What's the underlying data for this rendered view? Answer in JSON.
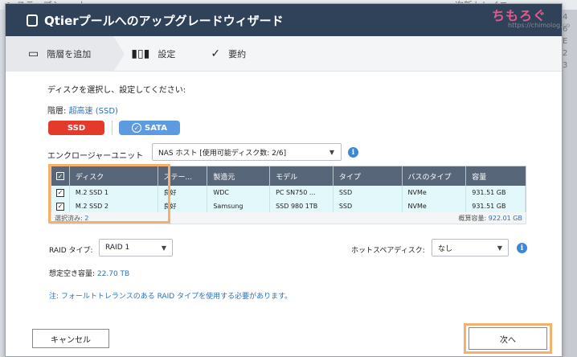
{
  "background": {
    "left_text": "ヘ ステップショット",
    "right_text": "次新トレイニー",
    "right_side": [
      "4",
      "6",
      "E",
      "2",
      "3"
    ]
  },
  "watermark": {
    "title": "ちもろぐ",
    "url": "https://chimolog.co"
  },
  "dialog": {
    "title": "Qtierプールへのアップグレードウィザード",
    "steps": [
      {
        "label": "階層を追加",
        "icon": "drive-icon"
      },
      {
        "label": "設定",
        "icon": "settings-icon"
      },
      {
        "label": "要約",
        "icon": "check-circle-icon"
      }
    ]
  },
  "form": {
    "heading": "ディスクを選択し、設定してください:",
    "tier_label": "階層:",
    "tier_value": "超高速 (SSD)",
    "tier_buttons": {
      "ssd": "SSD",
      "sata": "SATA"
    },
    "enclosure_label": "エンクロージャーユニット",
    "enclosure_value": "NAS ホスト [使用可能ディスク数: 2/6]",
    "table": {
      "headers": [
        "ディスク",
        "ステー...",
        "製造元",
        "モデル",
        "タイプ",
        "バスのタイプ",
        "容量"
      ],
      "rows": [
        [
          "M.2 SSD 1",
          "良好",
          "WDC",
          "PC SN750 ...",
          "SSD",
          "NVMe",
          "931.51 GB"
        ],
        [
          "M.2 SSD 2",
          "良好",
          "Samsung",
          "SSD 980 1TB",
          "SSD",
          "NVMe",
          "931.51 GB"
        ]
      ],
      "selected_label": "選択済み:",
      "selected_value": "2",
      "total_label": "概算容量:",
      "total_value": "922.01 GB"
    },
    "raid_label": "RAID タイプ:",
    "raid_value": "RAID 1",
    "spare_label": "ホットスペアディスク:",
    "spare_value": "なし",
    "capacity_label": "想定空き容量:",
    "capacity_value": "22.70 TB",
    "note": "注: フォールトトレランスのある RAID タイプを使用する必要があります。",
    "cancel_label": "キャンセル",
    "next_label": "次へ"
  },
  "colors": {
    "titlebar": "#2f4259",
    "ssd": "#e33a2c",
    "sata": "#5d9be0",
    "highlight": "#f4b16e",
    "link": "#2a6fbe"
  }
}
